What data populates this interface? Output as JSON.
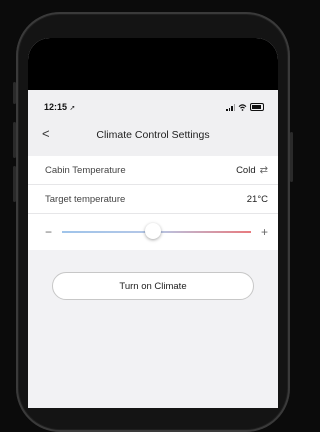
{
  "status_bar": {
    "time": "12:15",
    "location_icon": "location-arrow-icon",
    "signal_icon": "signal-icon",
    "wifi_icon": "wifi-icon",
    "battery_icon": "battery-icon"
  },
  "nav": {
    "back_icon": "chevron-left-icon",
    "back_glyph": "<",
    "title": "Climate Control Settings"
  },
  "settings": {
    "cabin_label": "Cabin Temperature",
    "cabin_value": "Cold",
    "cabin_icon": "swap-icon",
    "target_label": "Target temperature",
    "target_value": "21°C"
  },
  "slider": {
    "minus": "−",
    "plus": "+",
    "level_percent": 48,
    "gradient_start": "#9fc4ea",
    "gradient_end": "#e87a7e"
  },
  "action": {
    "label": "Turn on Climate"
  }
}
